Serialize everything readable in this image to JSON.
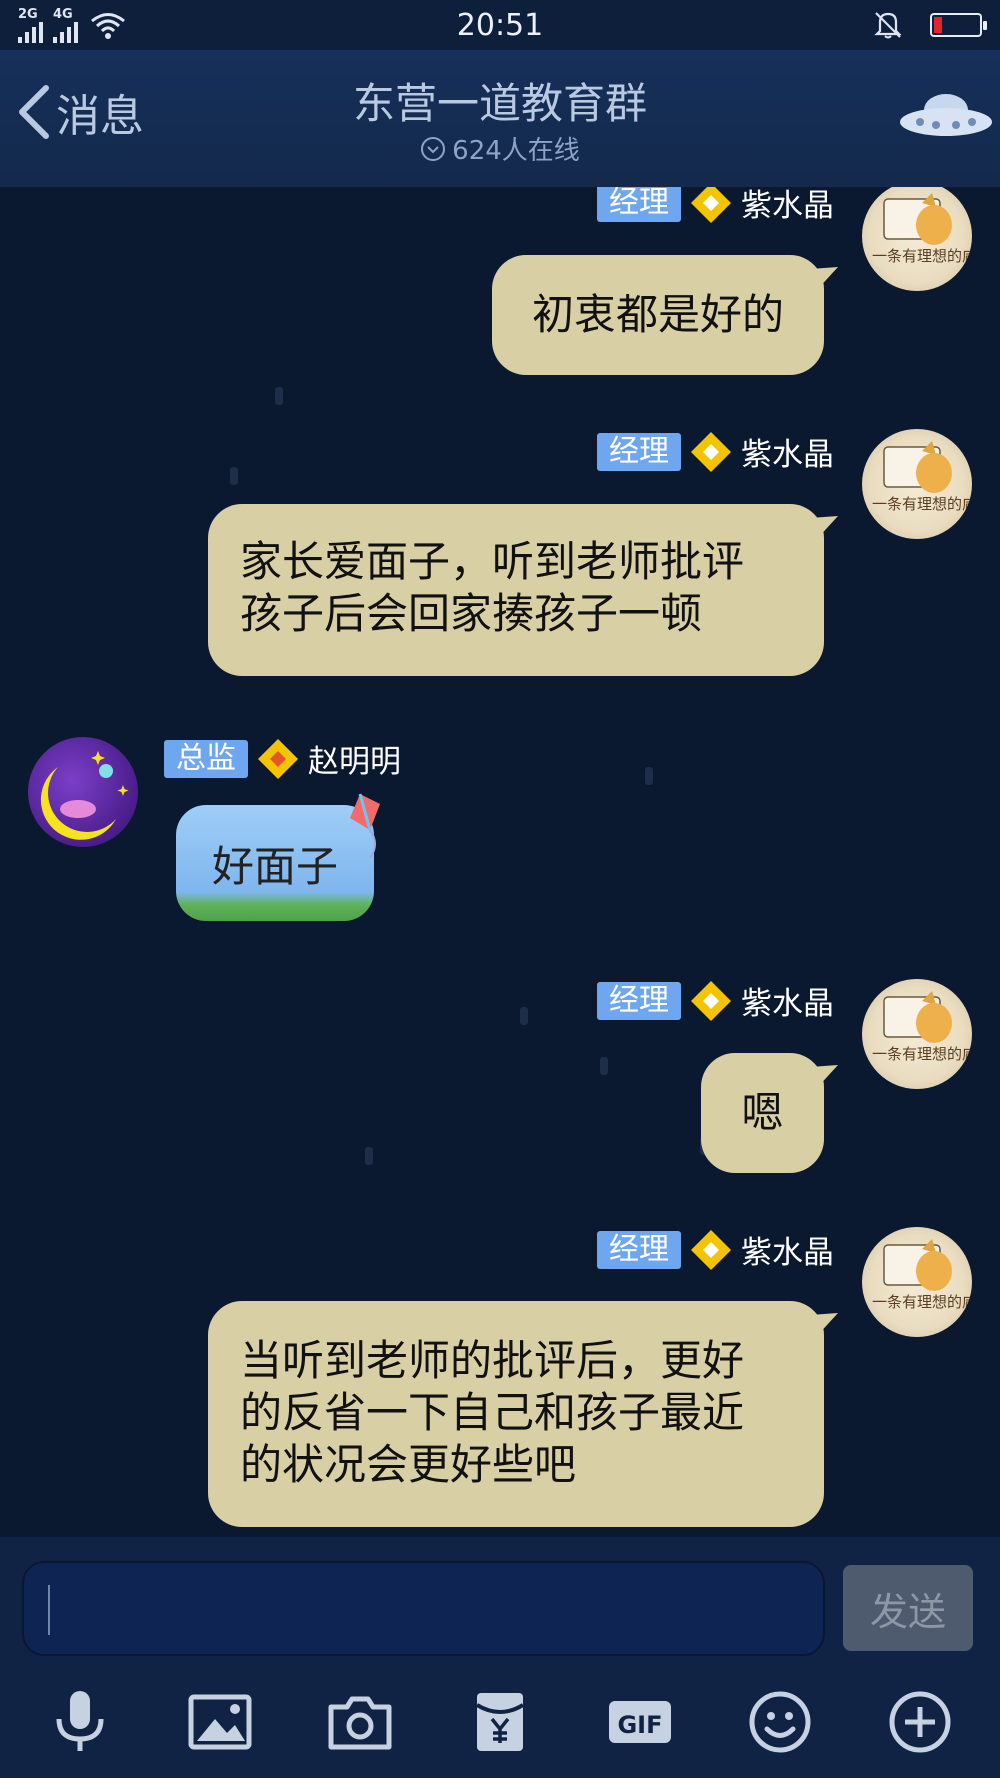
{
  "status_bar": {
    "net_a": "2G",
    "net_b": "4G",
    "time": "20:51"
  },
  "header": {
    "back_label": "消息",
    "title": "东营一道教育群",
    "online_count": "624人在线"
  },
  "messages": [
    {
      "side": "right",
      "role": "经理",
      "name": "紫水晶",
      "lines": [
        "初衷都是好的"
      ]
    },
    {
      "side": "right",
      "role": "经理",
      "name": "紫水晶",
      "lines": [
        "家长爱面子，听到老师批评",
        "孩子后会回家揍孩子一顿"
      ]
    },
    {
      "side": "left",
      "role": "总监",
      "name": "赵明明",
      "lines": [
        "好面子"
      ]
    },
    {
      "side": "right",
      "role": "经理",
      "name": "紫水晶",
      "lines": [
        "嗯"
      ]
    },
    {
      "side": "right",
      "role": "经理",
      "name": "紫水晶",
      "lines": [
        "当听到老师的批评后，更好",
        "的反省一下自己和孩子最近",
        "的状况会更好些吧"
      ]
    }
  ],
  "input": {
    "send_label": "发送"
  },
  "toolbar": {
    "icons": [
      "microphone-icon",
      "image-icon",
      "camera-icon",
      "red-packet-icon",
      "gif-icon",
      "emoji-icon",
      "plus-icon"
    ],
    "gif_text": "GIF"
  },
  "colors": {
    "bubble_self": "#d8cfa5",
    "tag_bg": "#6fa6f0",
    "background": "#0a1830",
    "header": "#14294c"
  }
}
